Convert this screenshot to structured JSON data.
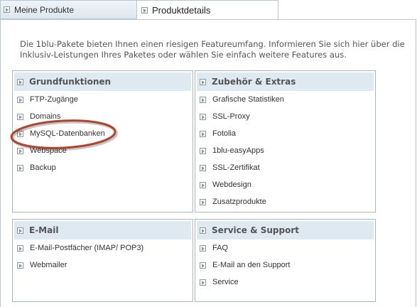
{
  "tabs": [
    {
      "label": "Meine Produkte",
      "active": false
    },
    {
      "label": "Produktdetails",
      "active": true
    }
  ],
  "intro": {
    "text": "Die 1blu-Pakete bieten Ihnen einen riesigen Featureumfang. Informieren Sie sich hier über die Inklusiv-Leistungen Ihres Paketes oder wählen Sie einfach weitere Features aus."
  },
  "panels": [
    {
      "title": "Grundfunktionen",
      "items": [
        "FTP-Zugänge",
        "Domains",
        "MySQL-Datenbanken",
        "Webspace",
        "Backup"
      ]
    },
    {
      "title": "Zubehör & Extras",
      "items": [
        "Grafische Statistiken",
        "SSL-Proxy",
        "Fotolia",
        "1blu-easyApps",
        "SSL-Zertifikat",
        "Webdesign",
        "Zusatzprodukte"
      ]
    },
    {
      "title": "E-Mail",
      "items": [
        "E-Mail-Postfächer (IMAP/ POP3)",
        "Webmailer"
      ]
    },
    {
      "title": "Service & Support",
      "items": [
        "FAQ",
        "E-Mail an den Support",
        "Service"
      ]
    }
  ],
  "annotation": {
    "color": "#b0432e",
    "target": "MySQL-Datenbanken"
  },
  "colors": {
    "header_bg": "#dfe9f1",
    "border": "#a9b5c2",
    "tab_border": "#b9c6d2"
  },
  "icons": {
    "item_icon": "arrow-icon"
  }
}
